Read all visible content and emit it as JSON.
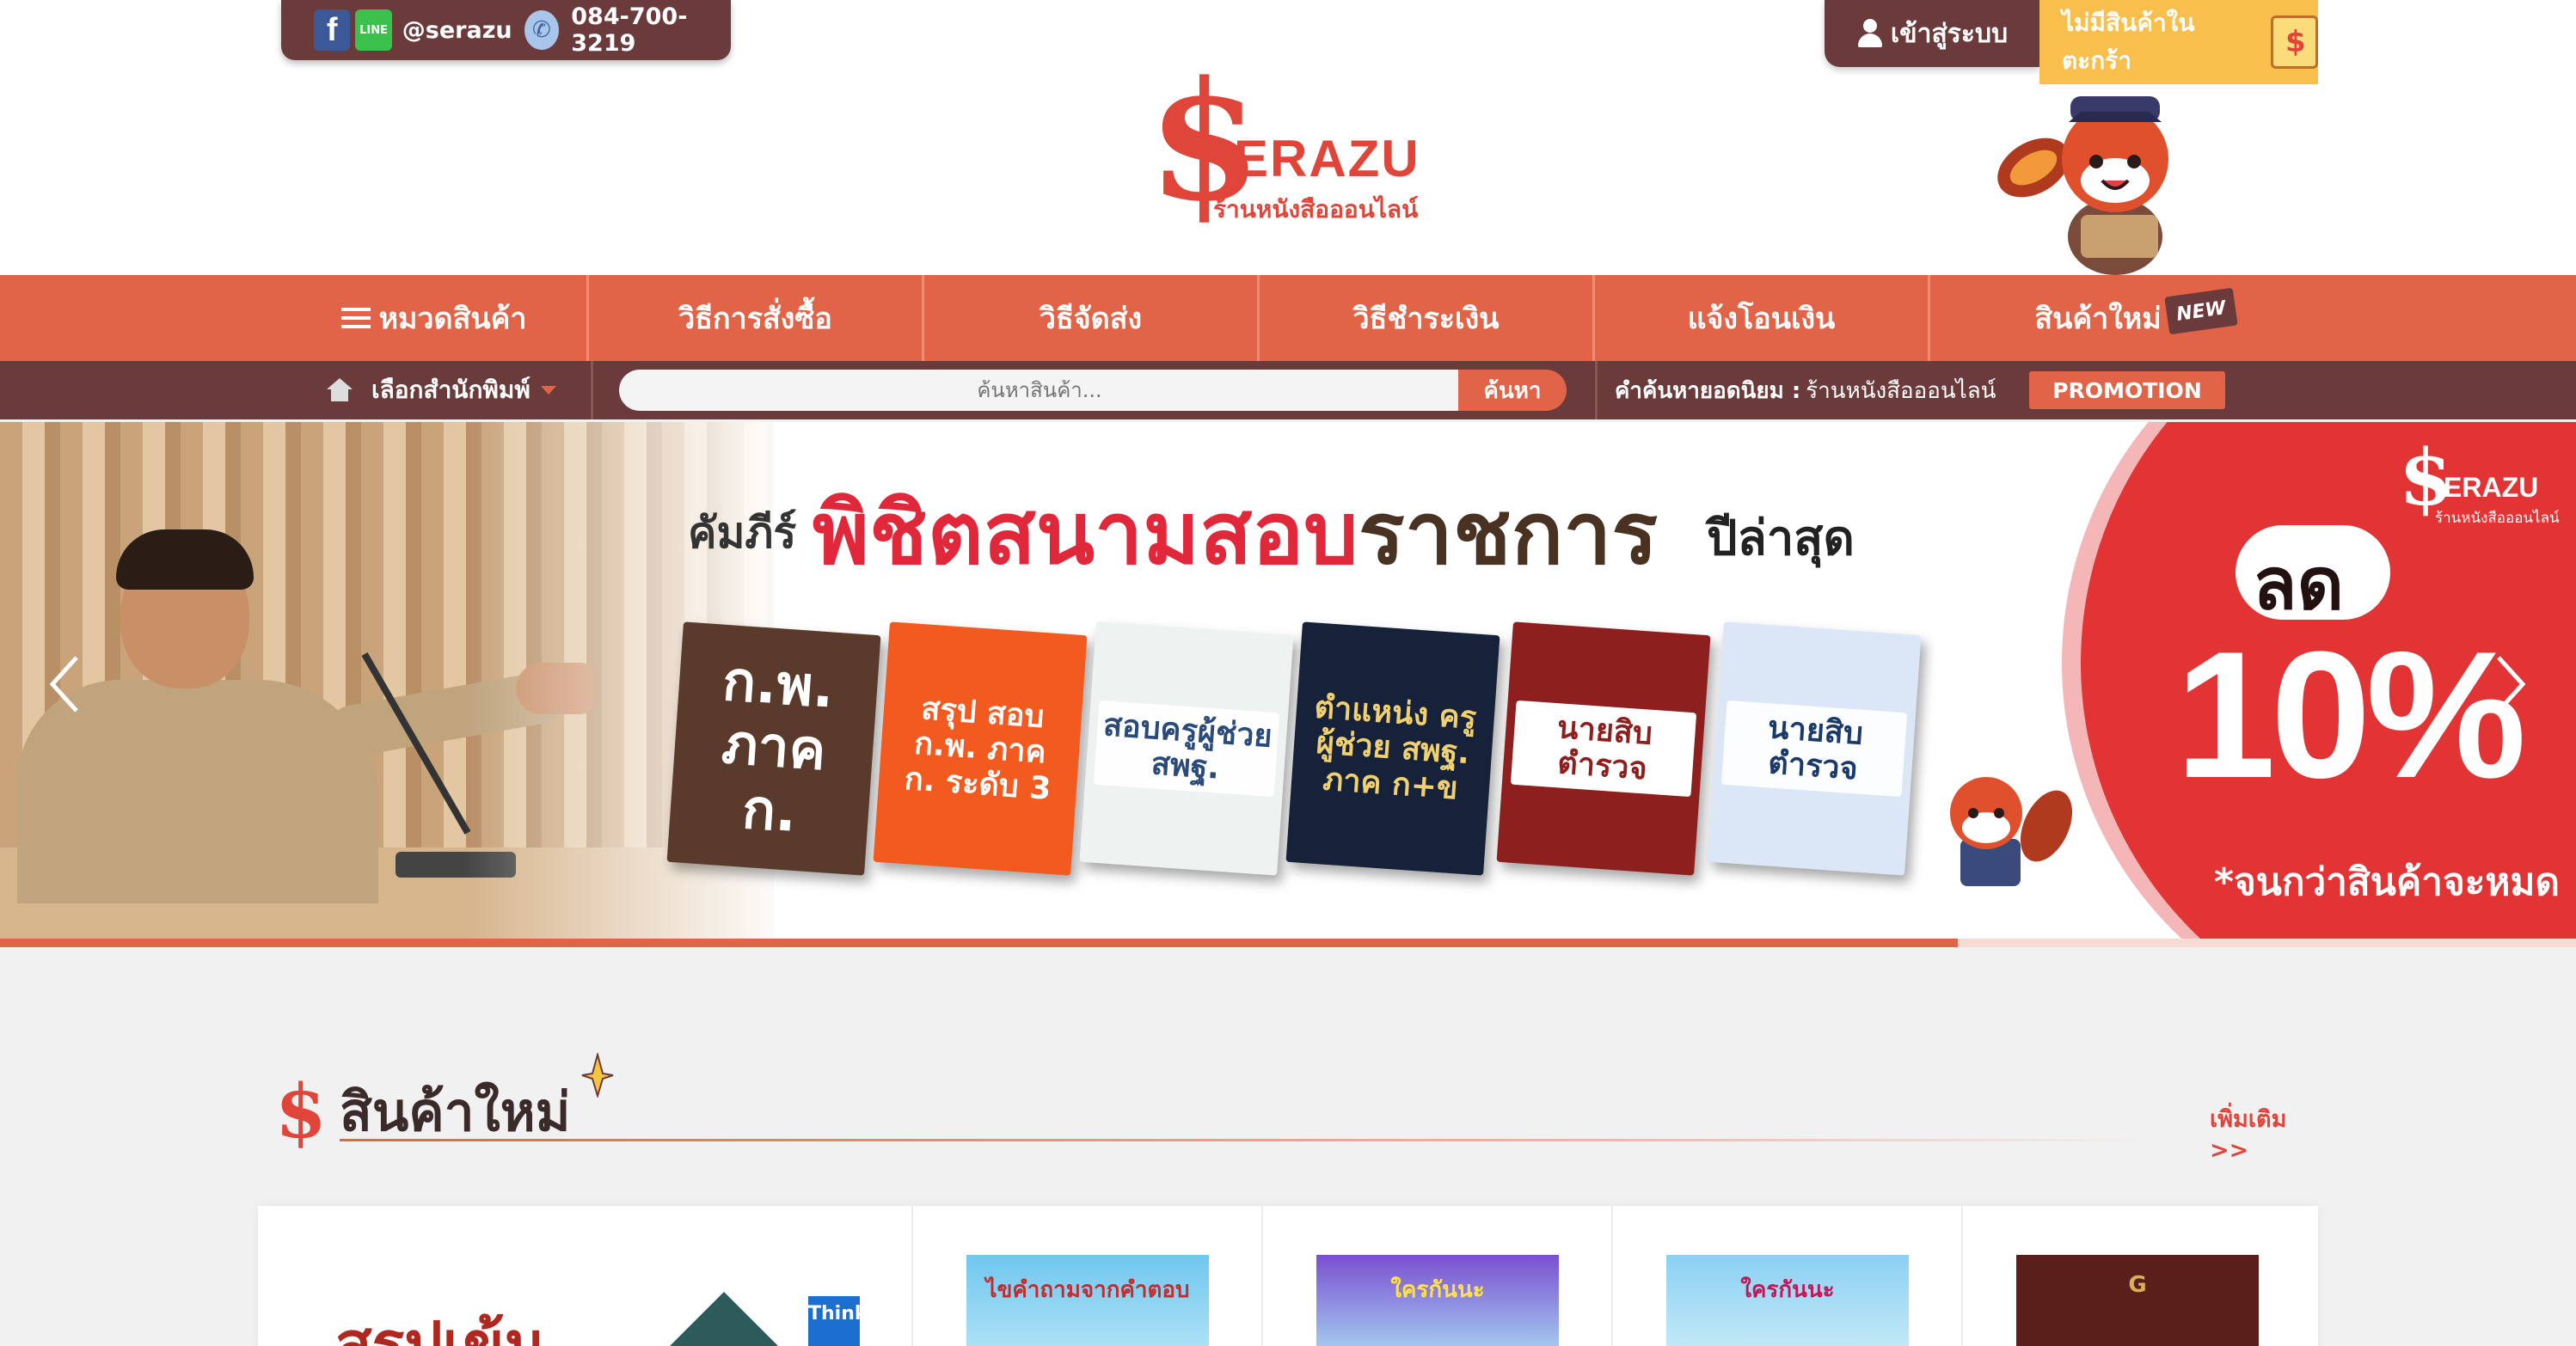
{
  "header": {
    "social": {
      "facebook_icon": "facebook-icon",
      "line_icon": "line-icon",
      "line_label": "LINE",
      "handle": "@serazu",
      "phone": "084-700-3219"
    },
    "login_label": "เข้าสู่ระบบ",
    "cart_label": "ไม่มีสินค้าในตะกร้า",
    "logo": {
      "word": "ERAZU",
      "subtitle": "ร้านหนังสือออนไลน์"
    }
  },
  "main_nav": {
    "items": [
      {
        "label": "หมวดสินค้า"
      },
      {
        "label": "วิธีการสั่งซื้อ"
      },
      {
        "label": "วิธีจัดส่ง"
      },
      {
        "label": "วิธีชำระเงิน"
      },
      {
        "label": "แจ้งโอนเงิน"
      },
      {
        "label": "สินค้าใหม่"
      }
    ],
    "new_badge": "NEW"
  },
  "sub_bar": {
    "publisher_label": "เลือกสำนักพิมพ์",
    "search_placeholder": "ค้นหาสินค้า...",
    "search_button": "ค้นหา",
    "popular_label": "คำค้นหายอดนิยม :",
    "popular_value": "ร้านหนังสือออนไลน์",
    "promotion_button": "PROMOTION"
  },
  "banner": {
    "title_part1": "คัมภีร์",
    "title_part2": "พิชิตสนามสอบ",
    "title_part3": "ราชการ",
    "title_part4": "ปีล่าสุด",
    "books": [
      {
        "title": "ก.พ. ภาค ก."
      },
      {
        "title": "สรุป สอบ ก.พ. ภาค ก. ระดับ 3"
      },
      {
        "title": "สอบครูผู้ช่วย สพฐ."
      },
      {
        "title": "ตำแหน่ง ครูผู้ช่วย สพฐ. ภาค ก+ข"
      },
      {
        "title": "นายสิบ ตำรวจ"
      },
      {
        "title": "นายสิบตำรวจ"
      }
    ],
    "logo_word": "ERAZU",
    "logo_sub": "ร้านหนังสือออนไลน์",
    "discount_word": "ลด",
    "discount_value": "10%",
    "discount_note": "*จนกว่าสินค้าจะหมด",
    "slide_progress": 0.76,
    "colors": {
      "accent": "#e16448",
      "dark": "#6b3b3b",
      "sale_red": "#e23434"
    }
  },
  "new_products": {
    "title": "สินค้าใหม่",
    "more_link": "เพิ่มเติม >>",
    "featured_text": "สรุปเข้ม",
    "featured_badge": "Think",
    "items": [
      {
        "thumb_text": "ไขคำถามจากคำตอบ"
      },
      {
        "thumb_text": "ใครกันนะ"
      },
      {
        "thumb_text": "ใครกันนะ"
      },
      {
        "thumb_text": "G"
      }
    ]
  }
}
